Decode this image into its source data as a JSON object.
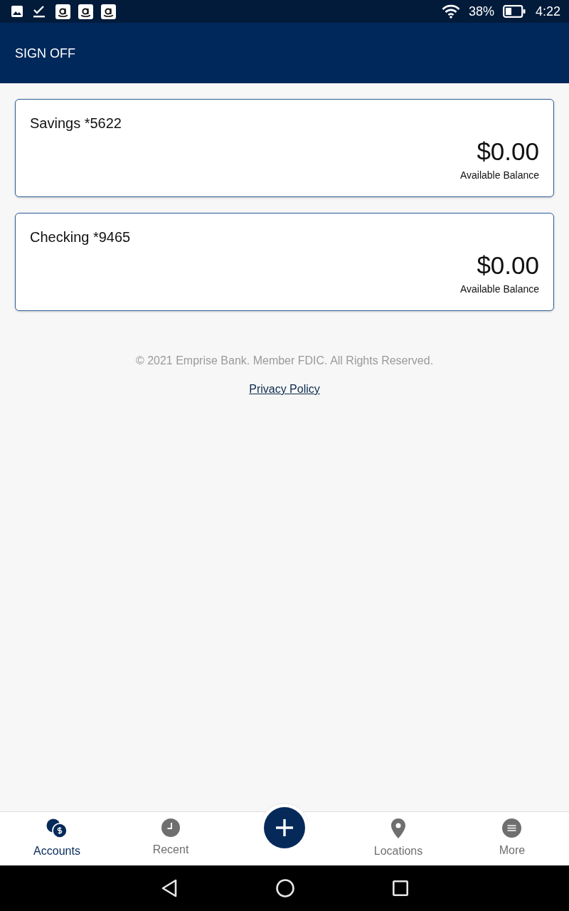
{
  "status_bar": {
    "battery_percent": "38%",
    "time": "4:22"
  },
  "header": {
    "sign_off": "SIGN OFF"
  },
  "accounts": [
    {
      "name": "Savings *5622",
      "balance": "$0.00",
      "balance_label": "Available Balance"
    },
    {
      "name": "Checking *9465",
      "balance": "$0.00",
      "balance_label": "Available Balance"
    }
  ],
  "footer": {
    "copyright": "© 2021 Emprise Bank. Member FDIC. All Rights Reserved.",
    "privacy_link": "Privacy Policy"
  },
  "bottom_nav": {
    "items": [
      {
        "kind": "tab",
        "label": "Accounts",
        "selected": true
      },
      {
        "kind": "tab",
        "label": "Recent",
        "selected": false
      },
      {
        "kind": "action"
      },
      {
        "kind": "tab",
        "label": "Locations",
        "selected": false
      },
      {
        "kind": "tab",
        "label": "More",
        "selected": false
      }
    ]
  }
}
